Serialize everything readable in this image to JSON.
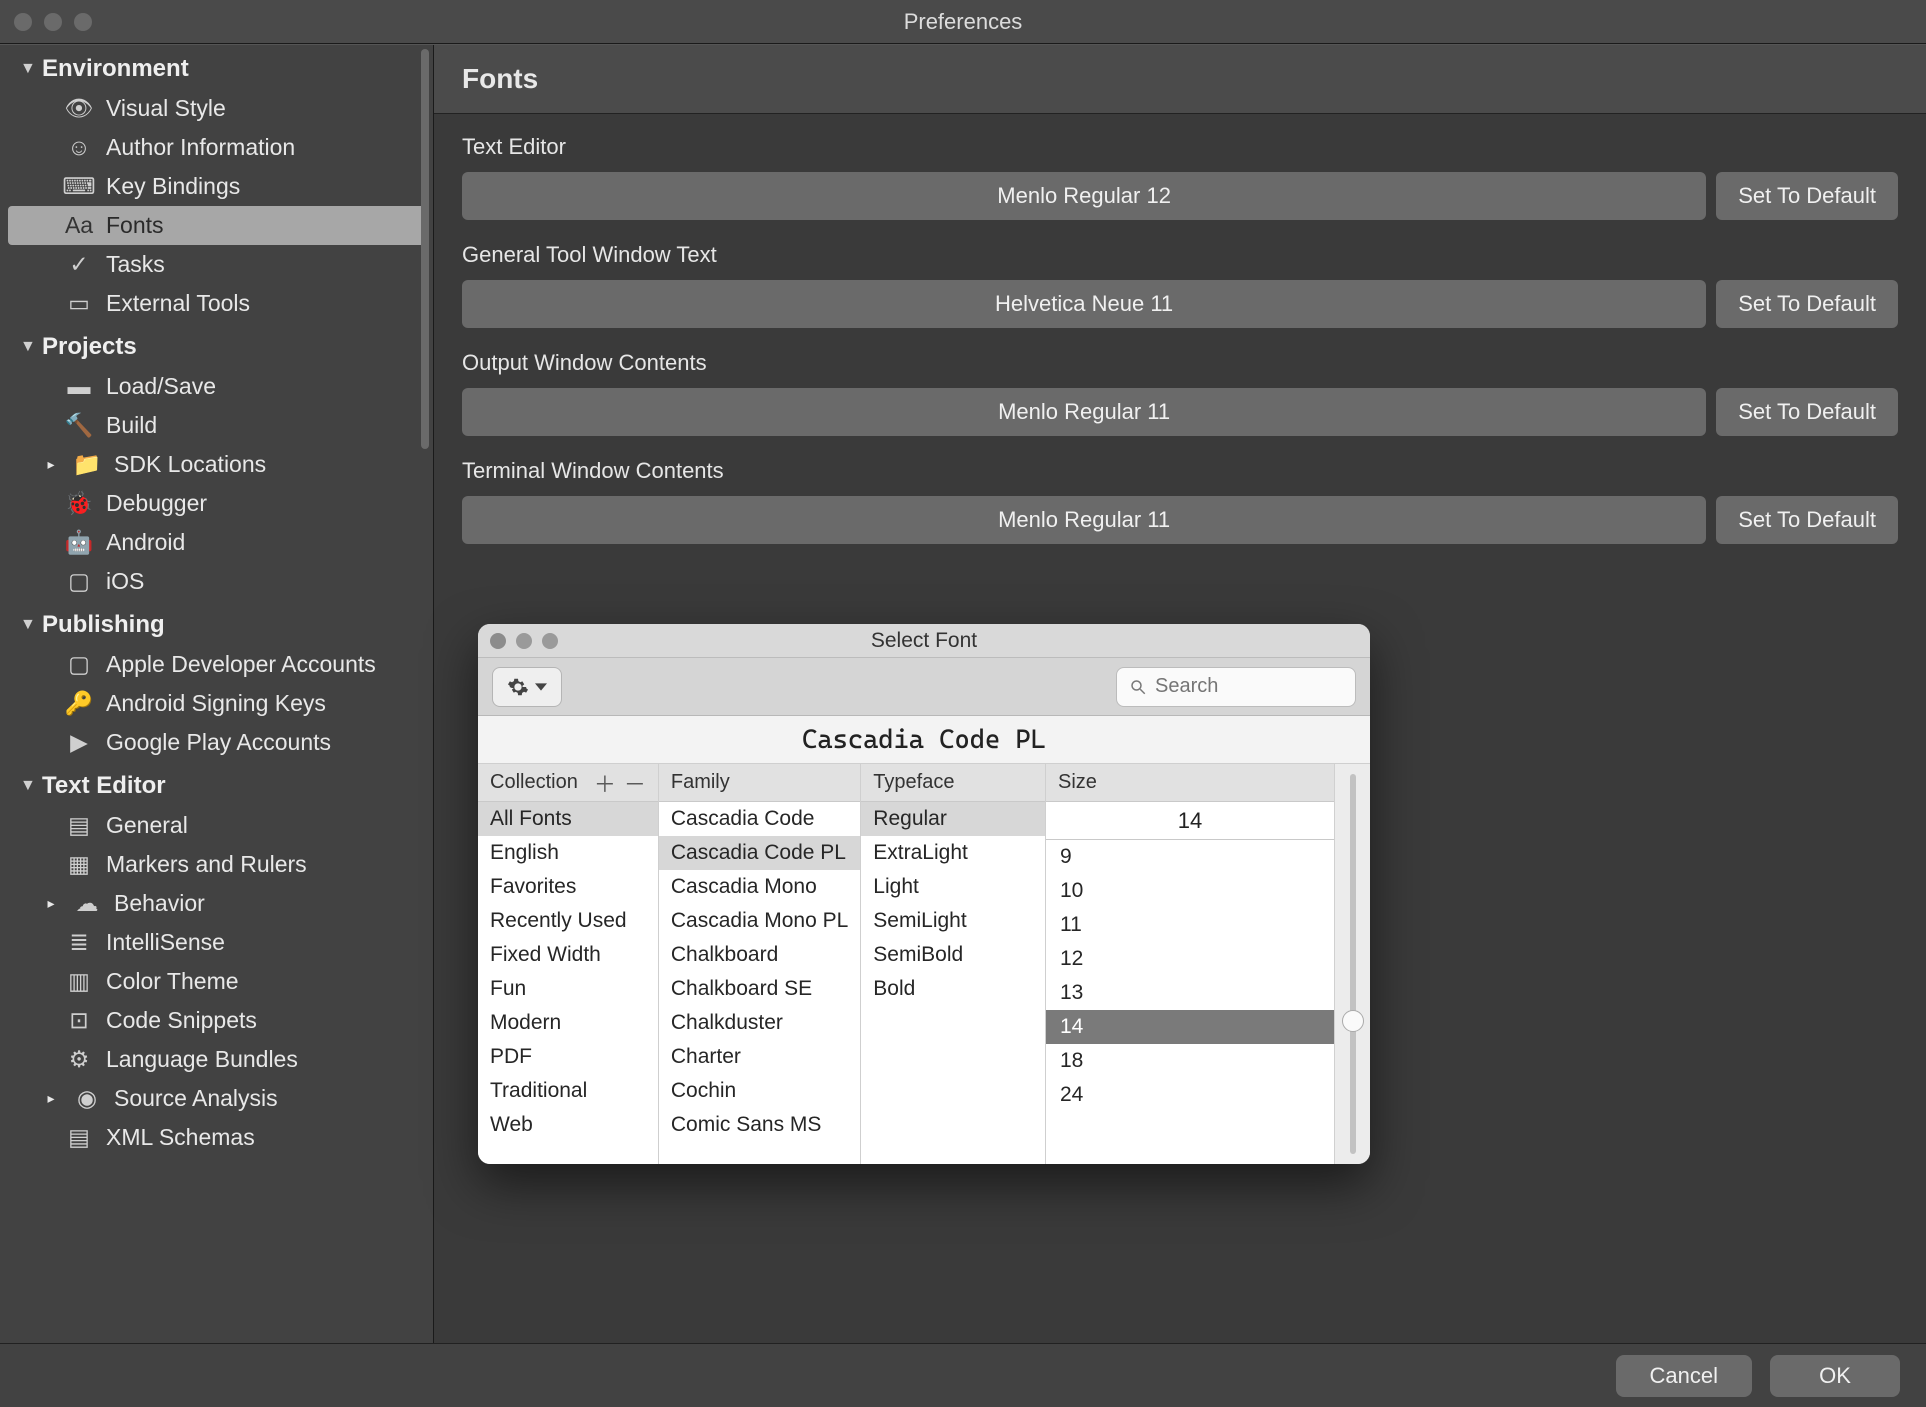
{
  "window": {
    "title": "Preferences"
  },
  "sidebar": {
    "sections": [
      {
        "title": "Environment",
        "items": [
          {
            "label": "Visual Style",
            "icon": "eye-icon"
          },
          {
            "label": "Author Information",
            "icon": "smile-icon"
          },
          {
            "label": "Key Bindings",
            "icon": "keyboard-icon"
          },
          {
            "label": "Fonts",
            "icon": "fonts-icon",
            "selected": true
          },
          {
            "label": "Tasks",
            "icon": "check-icon"
          },
          {
            "label": "External Tools",
            "icon": "external-icon"
          }
        ]
      },
      {
        "title": "Projects",
        "items": [
          {
            "label": "Load/Save",
            "icon": "disk-icon"
          },
          {
            "label": "Build",
            "icon": "hammer-icon"
          },
          {
            "label": "SDK Locations",
            "icon": "folder-icon",
            "disclosure": true
          },
          {
            "label": "Debugger",
            "icon": "bug-icon"
          },
          {
            "label": "Android",
            "icon": "android-icon"
          },
          {
            "label": "iOS",
            "icon": "apple-icon"
          }
        ]
      },
      {
        "title": "Publishing",
        "items": [
          {
            "label": "Apple Developer Accounts",
            "icon": "apple-icon"
          },
          {
            "label": "Android Signing Keys",
            "icon": "key-icon"
          },
          {
            "label": "Google Play Accounts",
            "icon": "play-icon"
          }
        ]
      },
      {
        "title": "Text Editor",
        "items": [
          {
            "label": "General",
            "icon": "doc-icon"
          },
          {
            "label": "Markers and Rulers",
            "icon": "rulers-icon"
          },
          {
            "label": "Behavior",
            "icon": "behavior-icon",
            "disclosure": true
          },
          {
            "label": "IntelliSense",
            "icon": "list-icon"
          },
          {
            "label": "Color Theme",
            "icon": "palette-icon"
          },
          {
            "label": "Code Snippets",
            "icon": "snippet-icon"
          },
          {
            "label": "Language Bundles",
            "icon": "gear-icon"
          },
          {
            "label": "Source Analysis",
            "icon": "target-icon",
            "disclosure": true
          },
          {
            "label": "XML Schemas",
            "icon": "doc-icon"
          }
        ]
      }
    ]
  },
  "main": {
    "title": "Fonts",
    "fields": [
      {
        "label": "Text Editor",
        "value": "Menlo Regular 12",
        "reset": "Set To Default"
      },
      {
        "label": "General Tool Window Text",
        "value": "Helvetica Neue 11",
        "reset": "Set To Default"
      },
      {
        "label": "Output Window Contents",
        "value": "Menlo Regular 11",
        "reset": "Set To Default"
      },
      {
        "label": "Terminal Window Contents",
        "value": "Menlo Regular 11",
        "reset": "Set To Default"
      }
    ]
  },
  "footer": {
    "cancel": "Cancel",
    "ok": "OK"
  },
  "picker": {
    "title": "Select Font",
    "search_placeholder": "Search",
    "preview": "Cascadia Code PL",
    "columns": {
      "collection": {
        "header": "Collection",
        "items": [
          "All Fonts",
          "English",
          "Favorites",
          "Recently Used",
          "Fixed Width",
          "Fun",
          "Modern",
          "PDF",
          "Traditional",
          "Web"
        ],
        "selected": "All Fonts"
      },
      "family": {
        "header": "Family",
        "items": [
          "Cascadia Code",
          "Cascadia Code PL",
          "Cascadia Mono",
          "Cascadia Mono PL",
          "Chalkboard",
          "Chalkboard SE",
          "Chalkduster",
          "Charter",
          "Cochin",
          "Comic Sans MS"
        ],
        "selected": "Cascadia Code PL"
      },
      "typeface": {
        "header": "Typeface",
        "items": [
          "Regular",
          "ExtraLight",
          "Light",
          "SemiLight",
          "SemiBold",
          "Bold"
        ],
        "selected": "Regular"
      },
      "size": {
        "header": "Size",
        "current": "14",
        "items": [
          "9",
          "10",
          "11",
          "12",
          "13",
          "14",
          "18",
          "24"
        ],
        "selected": "14"
      }
    }
  }
}
